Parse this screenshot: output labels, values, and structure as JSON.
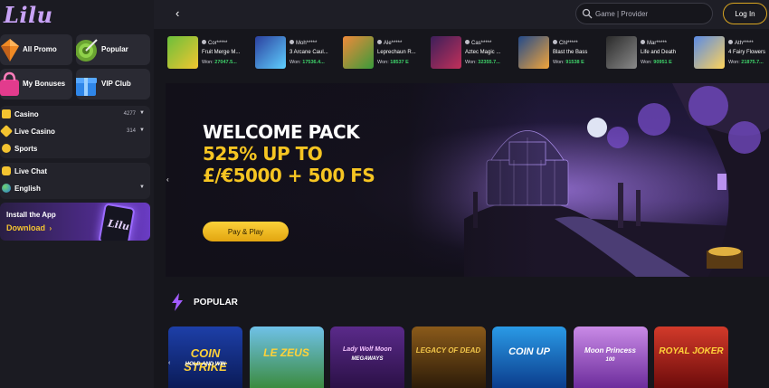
{
  "brand": {
    "logo_text": "Lilu"
  },
  "sidebar": {
    "tiles": [
      {
        "label": "All Promo",
        "icon": "gem-icon"
      },
      {
        "label": "Popular",
        "icon": "target-icon"
      },
      {
        "label": "My Bonuses",
        "icon": "shopping-bag-icon"
      },
      {
        "label": "VIP Club",
        "icon": "gift-box-icon"
      }
    ],
    "nav": [
      {
        "label": "Casino",
        "count": "4277",
        "icon": "dice-icon"
      },
      {
        "label": "Live Casino",
        "count": "314",
        "icon": "live-icon"
      },
      {
        "label": "Sports",
        "icon": "ball-icon"
      }
    ],
    "extra": [
      {
        "label": "Live Chat",
        "icon": "chat-icon"
      },
      {
        "label": "English",
        "icon": "globe-icon"
      }
    ],
    "app_banner": {
      "line1": "Install the App",
      "line2": "Download",
      "arrow": "›",
      "phone_logo": "Lilu"
    }
  },
  "topbar": {
    "back": "‹",
    "search_placeholder": "Game | Provider",
    "login_label": "Log In"
  },
  "recent_wins": [
    {
      "user": "Cor*****",
      "game": "Fruit Merge M...",
      "won_label": "Won:",
      "amount": "27047.5..."
    },
    {
      "user": "Moh*****",
      "game": "3 Arcane Caul...",
      "won_label": "Won:",
      "amount": "17536.4..."
    },
    {
      "user": "Ale*****",
      "game": "Leprechaun R...",
      "won_label": "Won:",
      "amount": "18537 E"
    },
    {
      "user": "Cas*****",
      "game": "Aztec Magic ...",
      "won_label": "Won:",
      "amount": "32355.7..."
    },
    {
      "user": "Chl*****",
      "game": "Blast the Bass",
      "won_label": "Won:",
      "amount": "91538 E"
    },
    {
      "user": "Mar*****",
      "game": "Life and Death",
      "won_label": "Won:",
      "amount": "90951 E"
    },
    {
      "user": "Ath*****",
      "game": "4 Fairy Flowers",
      "won_label": "Won:",
      "amount": "21875.7..."
    }
  ],
  "hero": {
    "line1": "WELCOME PACK",
    "line2": "525% UP TO",
    "line3": "£/€5000 + 500 FS",
    "cta": "Pay & Play",
    "prev_arrow": "‹"
  },
  "popular": {
    "title": "POPULAR",
    "prev_arrow": "‹",
    "games": [
      {
        "name": "COIN STRIKE",
        "sub": "HOLD AND WIN"
      },
      {
        "name": "LE ZEUS",
        "sub": ""
      },
      {
        "name": "Lady Wolf Moon",
        "sub": "MEGAWAYS"
      },
      {
        "name": "LEGACY OF DEAD",
        "sub": ""
      },
      {
        "name": "COIN UP",
        "sub": ""
      },
      {
        "name": "Moon Princess",
        "sub": "100"
      },
      {
        "name": "ROYAL JOKER",
        "sub": ""
      }
    ]
  },
  "colors": {
    "accent": "#f6c522",
    "win_green": "#3fd36a",
    "bg": "#16161c",
    "panel": "#23232b"
  }
}
